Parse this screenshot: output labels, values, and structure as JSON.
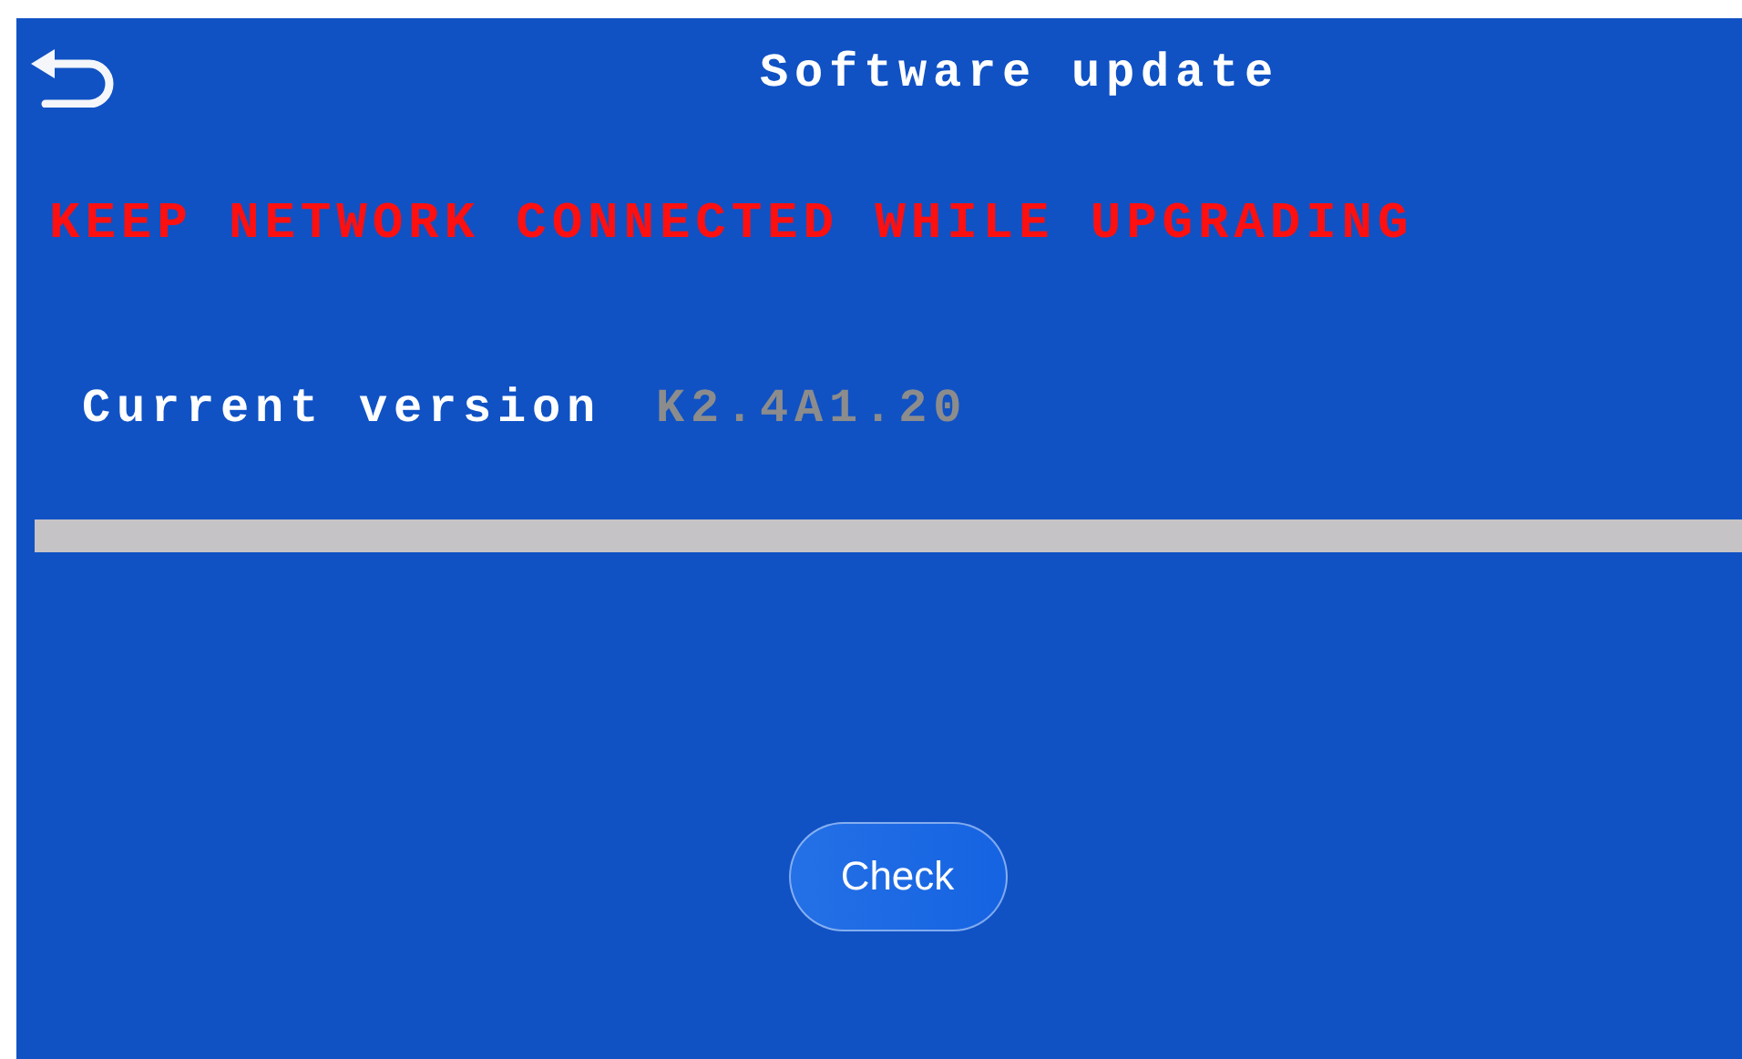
{
  "header": {
    "title": "Software update"
  },
  "warning": "KEEP NETWORK CONNECTED WHILE UPGRADING",
  "version": {
    "label": "Current version",
    "value": "K2.4A1.20"
  },
  "button": "Check"
}
